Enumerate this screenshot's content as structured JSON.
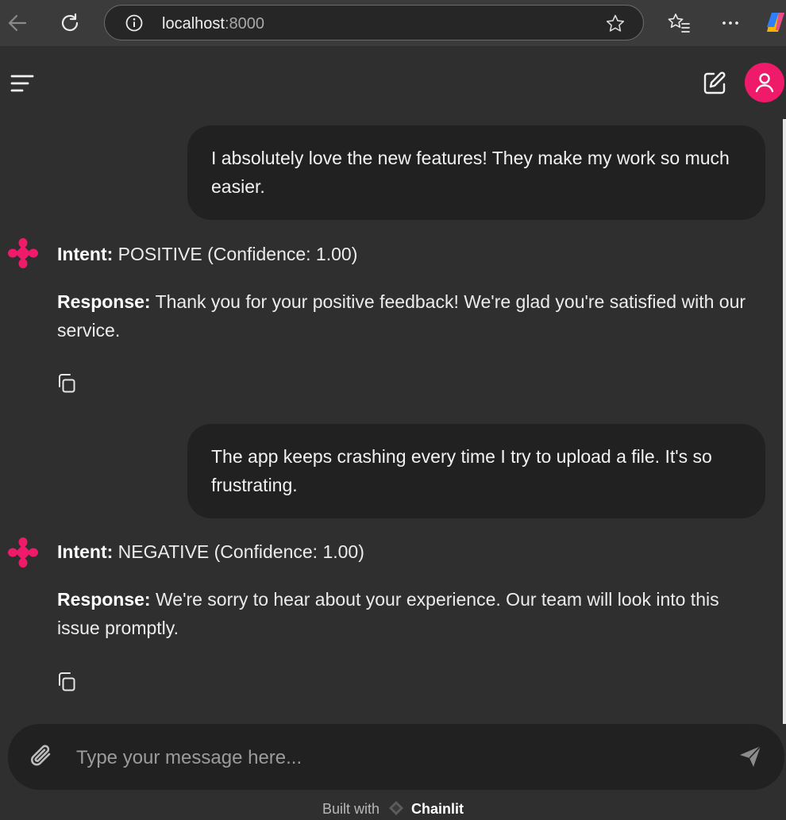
{
  "browser": {
    "url_host": "localhost",
    "url_port": ":8000"
  },
  "chat": {
    "messages": [
      {
        "role": "user",
        "text": "I absolutely love the new features! They make my work so much easier."
      },
      {
        "role": "assistant",
        "intent_label": "Intent:",
        "intent_value": " POSITIVE (Confidence: 1.00)",
        "response_label": "Response:",
        "response_value": " Thank you for your positive feedback! We're glad you're satisfied with our service."
      },
      {
        "role": "user",
        "text": "The app keeps crashing every time I try to upload a file. It's so frustrating."
      },
      {
        "role": "assistant",
        "intent_label": "Intent:",
        "intent_value": " NEGATIVE (Confidence: 1.00)",
        "response_label": "Response:",
        "response_value": " We're sorry to hear about your experience. Our team will look into this issue promptly."
      }
    ]
  },
  "composer": {
    "placeholder": "Type your message here..."
  },
  "footer": {
    "prefix": "Built with",
    "brand": "Chainlit"
  },
  "icons": {
    "back": "arrow-left-icon",
    "reload": "reload-icon",
    "info": "info-icon",
    "star": "star-icon",
    "favorites": "favorites-icon",
    "more": "more-icon",
    "menu": "menu-icon",
    "new_chat": "edit-icon",
    "user": "user-icon",
    "copy": "copy-icon",
    "attach": "paperclip-icon",
    "send": "send-icon"
  },
  "colors": {
    "accent": "#ef1a6a",
    "background": "#2f2f2f",
    "bubble": "#212121"
  }
}
